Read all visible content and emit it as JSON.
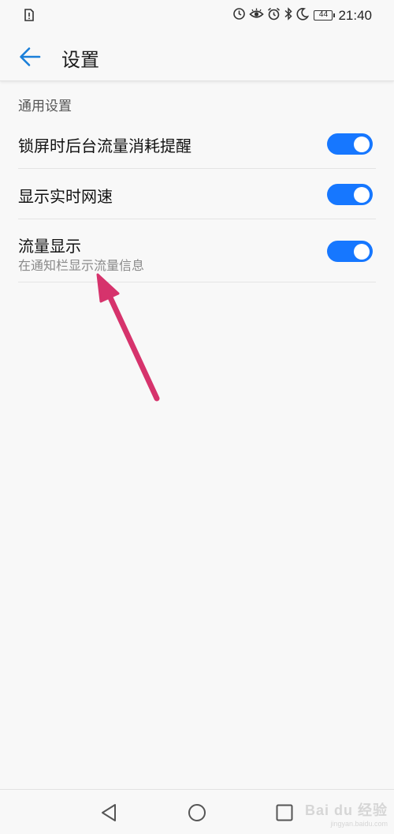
{
  "status_bar": {
    "time": "21:40",
    "battery_level": "44",
    "icons": [
      "sim-alert-icon",
      "data-saver-icon",
      "eye-comfort-icon",
      "alarm-icon",
      "bluetooth-icon",
      "do-not-disturb-moon-icon",
      "battery-icon"
    ]
  },
  "app_bar": {
    "title": "设置",
    "back_icon": "back-arrow-icon"
  },
  "section": {
    "header": "通用设置"
  },
  "settings": [
    {
      "title": "锁屏时后台流量消耗提醒",
      "subtitle": "",
      "enabled": true
    },
    {
      "title": "显示实时网速",
      "subtitle": "",
      "enabled": true
    },
    {
      "title": "流量显示",
      "subtitle": "在通知栏显示流量信息",
      "enabled": true
    }
  ],
  "nav_bar": {
    "icons": [
      "nav-back-icon",
      "nav-home-icon",
      "nav-recent-apps-icon"
    ]
  },
  "watermark": {
    "text": "Bai du 经验",
    "sub": "jingyan.baidu.com"
  },
  "colors": {
    "accent": "#1677ff",
    "annotation_arrow": "#d6336c",
    "background": "#f8f8f8"
  }
}
